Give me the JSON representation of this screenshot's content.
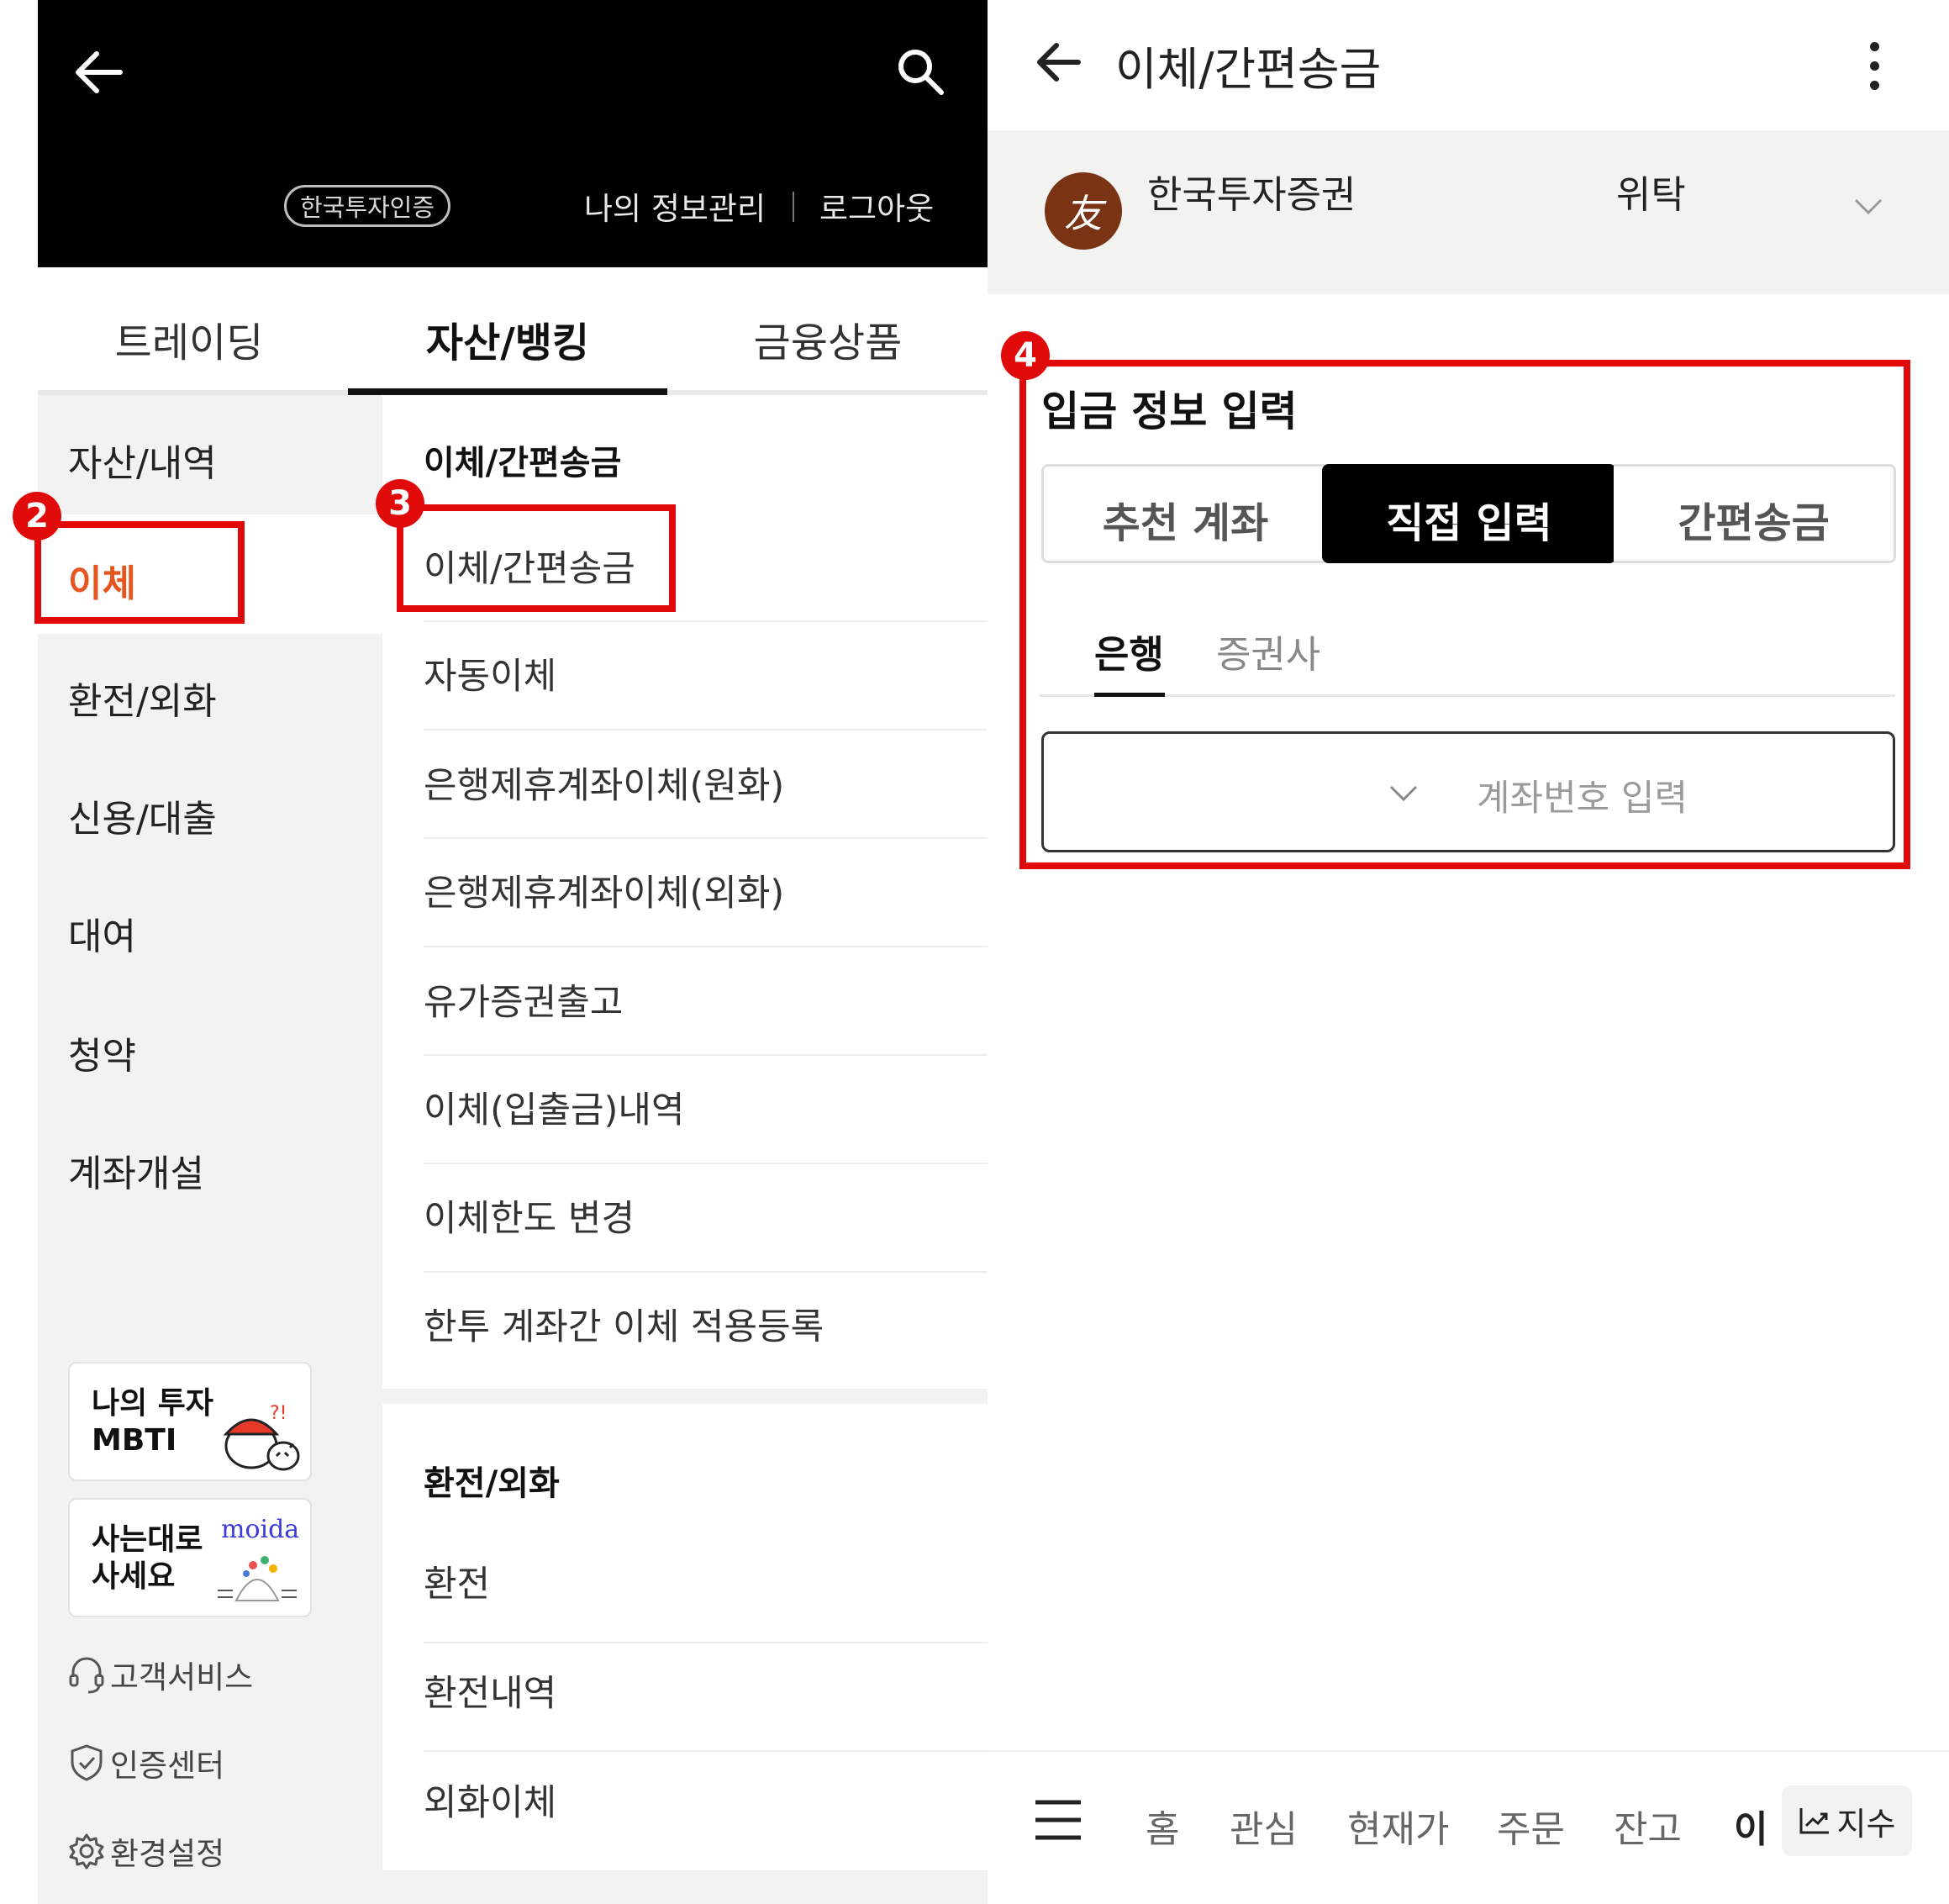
{
  "left": {
    "header": {
      "cert_label": "한국투자인증",
      "my_info": "나의 정보관리",
      "logout": "로그아웃"
    },
    "tabs": [
      "트레이딩",
      "자산/뱅킹",
      "금융상품"
    ],
    "sidebar": {
      "items": [
        "자산/내역",
        "이체",
        "환전/외화",
        "신용/대출",
        "대여",
        "청약",
        "계좌개설"
      ],
      "banners": [
        "나의 투자\nMBTI",
        "사는대로\n사세요"
      ],
      "banner_logo": "moida",
      "utilities": [
        "고객서비스",
        "인증센터",
        "환경설정"
      ]
    },
    "menu": {
      "section1_title": "이체/간편송금",
      "section1_items": [
        "이체/간편송금",
        "자동이체",
        "은행제휴계좌이체(원화)",
        "은행제휴계좌이체(외화)",
        "유가증권출고",
        "이체(입출금)내역",
        "이체한도 변경",
        "한투 계좌간 이체 적용등록"
      ],
      "section2_title": "환전/외화",
      "section2_items": [
        "환전",
        "환전내역",
        "외화이체"
      ]
    }
  },
  "right": {
    "title": "이체/간편송금",
    "account": {
      "logo_char": "友",
      "name": "한국투자증권",
      "type": "위탁"
    },
    "deposit": {
      "heading": "입금 정보 입력",
      "segments": [
        "추천 계좌",
        "직접 입력",
        "간편송금"
      ],
      "sub_tabs": [
        "은행",
        "증권사"
      ],
      "account_placeholder": "계좌번호 입력"
    },
    "bottom_nav": {
      "items": [
        "홈",
        "관심",
        "현재가",
        "주문",
        "잔고",
        "이"
      ],
      "index_label": "지수"
    }
  },
  "annotations": [
    "2",
    "3",
    "4"
  ],
  "colors": {
    "accent_orange": "#e5551f",
    "annotation_red": "#e10a0a",
    "header_black": "#000000",
    "logo_brown": "#7a3414"
  }
}
